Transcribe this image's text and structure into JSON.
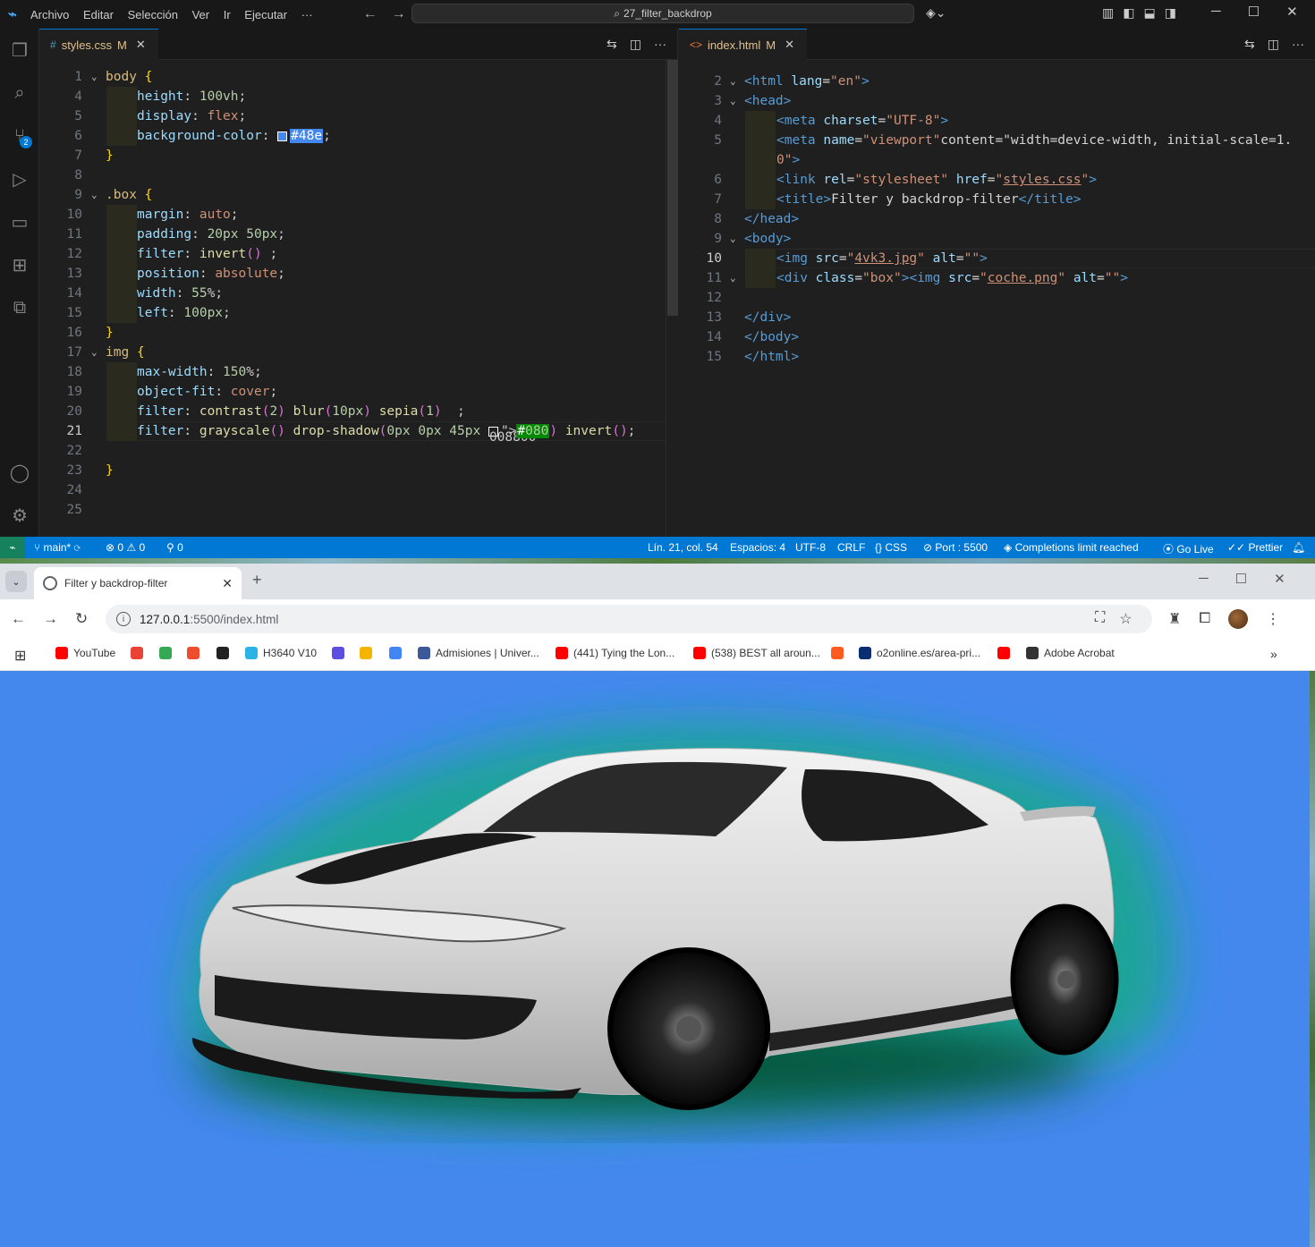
{
  "vscode": {
    "menu": [
      "Archivo",
      "Editar",
      "Selección",
      "Ver",
      "Ir",
      "Ejecutar",
      "···"
    ],
    "command_center": "27_filter_backdrop",
    "activity_badge": "2",
    "left_tab": {
      "name": "styles.css",
      "status": "M",
      "icon": "#"
    },
    "right_tab": {
      "name": "index.html",
      "status": "M",
      "icon": "<>"
    },
    "css_lines": [
      {
        "n": "1",
        "text": "body {"
      },
      {
        "n": "4",
        "text": "height: 100vh;"
      },
      {
        "n": "5",
        "text": "display: flex;"
      },
      {
        "n": "6",
        "text": "background-color: #48e;"
      },
      {
        "n": "7",
        "text": "}"
      },
      {
        "n": "8",
        "text": ""
      },
      {
        "n": "9",
        "text": ".box {"
      },
      {
        "n": "10",
        "text": "margin: auto;"
      },
      {
        "n": "11",
        "text": "padding: 20px 50px;"
      },
      {
        "n": "12",
        "text": "filter: invert() ;"
      },
      {
        "n": "13",
        "text": "position: absolute;"
      },
      {
        "n": "14",
        "text": "width: 55%;"
      },
      {
        "n": "15",
        "text": "left: 100px;"
      },
      {
        "n": "16",
        "text": "}"
      },
      {
        "n": "17",
        "text": "img {"
      },
      {
        "n": "18",
        "text": "max-width: 150%;"
      },
      {
        "n": "19",
        "text": "object-fit: cover;"
      },
      {
        "n": "20",
        "text": "filter: contrast(2) blur(10px) sepia(1)  ;"
      },
      {
        "n": "21",
        "text": "filter: grayscale() drop-shadow(0px 0px 45px #080) invert();"
      },
      {
        "n": "22",
        "text": ""
      },
      {
        "n": "23",
        "text": "}"
      },
      {
        "n": "24",
        "text": ""
      },
      {
        "n": "25",
        "text": ""
      }
    ],
    "html_lines": [
      {
        "n": "2",
        "text": "<html lang=\"en\">"
      },
      {
        "n": "3",
        "text": "<head>"
      },
      {
        "n": "4",
        "text": "<meta charset=\"UTF-8\">"
      },
      {
        "n": "5",
        "text": "<meta name=\"viewport\" content=\"width=device-width, initial-scale=1."
      },
      {
        "n": "",
        "text": "0\">"
      },
      {
        "n": "6",
        "text": "<link rel=\"stylesheet\" href=\"styles.css\">"
      },
      {
        "n": "7",
        "text": "<title>Filter y backdrop-filter</title>"
      },
      {
        "n": "8",
        "text": "</head>"
      },
      {
        "n": "9",
        "text": "<body>"
      },
      {
        "n": "10",
        "text": "<img src=\"4vk3.jpg\" alt=\"\">"
      },
      {
        "n": "11",
        "text": "<div class=\"box\"><img src=\"coche.png\" alt=\"\">"
      },
      {
        "n": "12",
        "text": ""
      },
      {
        "n": "13",
        "text": "</div>"
      },
      {
        "n": "14",
        "text": "</body>"
      },
      {
        "n": "15",
        "text": "</html>"
      }
    ],
    "status": {
      "branch": "main*",
      "errors": "0",
      "warnings": "0",
      "ports": "0",
      "position": "Lín. 21, col. 54",
      "spaces": "Espacios: 4",
      "encoding": "UTF-8",
      "eol": "CRLF",
      "language": "CSS",
      "port": "Port : 5500",
      "completions": "Completions limit reached",
      "golive": "Go Live",
      "prettier": "Prettier"
    }
  },
  "chrome": {
    "tab_title": "Filter y backdrop-filter",
    "url_host": "127.0.0.1",
    "url_rest": ":5500/index.html",
    "bookmarks": [
      {
        "label": "YouTube",
        "color": "#ff0000"
      },
      {
        "label": "",
        "color": "#ea4335"
      },
      {
        "label": "",
        "color": "#34a853"
      },
      {
        "label": "",
        "color": "#ee4d2d"
      },
      {
        "label": "",
        "color": "#222222"
      },
      {
        "label": "H3640 V10",
        "color": "#2bb3e5"
      },
      {
        "label": "",
        "color": "#5b4ee0"
      },
      {
        "label": "",
        "color": "#f4b400"
      },
      {
        "label": "",
        "color": "#4285f4"
      },
      {
        "label": "Admisiones | Univer...",
        "color": "#3b5998"
      },
      {
        "label": "(441) Tying the Lon...",
        "color": "#ff0000"
      },
      {
        "label": "(538) BEST all aroun...",
        "color": "#ff0000"
      },
      {
        "label": "",
        "color": "#ff5a1f"
      },
      {
        "label": "o2online.es/area-pri...",
        "color": "#0b2d71"
      },
      {
        "label": "",
        "color": "#ff0000"
      },
      {
        "label": "Adobe Acrobat",
        "color": "#333333"
      }
    ],
    "page_background": "#4488ee",
    "shadow_color": "#008800"
  }
}
